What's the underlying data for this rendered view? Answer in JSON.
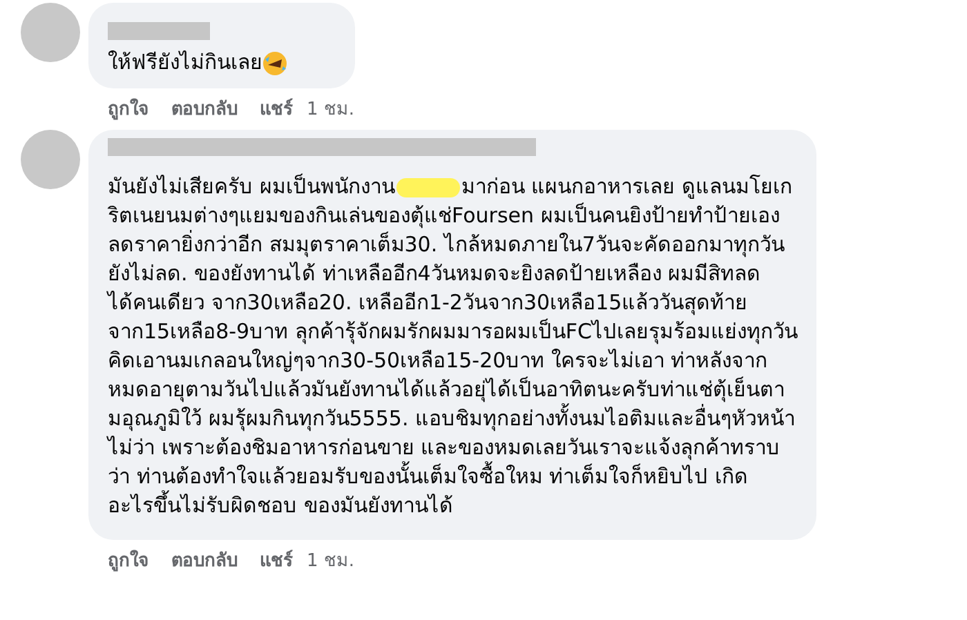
{
  "comments": [
    {
      "text_lines": [
        "ให้ฟรียังไม่กินเลย"
      ],
      "emoji": true,
      "redacted_first_line": false,
      "actions": [
        "ถูกใจ",
        "ตอบกลับ",
        "แชร์"
      ],
      "time": "1 ชม."
    },
    {
      "first_line_before": "มันยังไม่เสียครับ ผมเป็นพนักงาน",
      "first_line_after": "มาก่อน แผนกอาหารเลย ดูแลนมโยเก",
      "redacted_first_line": true,
      "emoji": false,
      "text_lines": [
        "ริตเนยนมต่างๆแยมของกินเล่นของตุ้แช่Foursen ผมเป็นคนยิงป้ายทำป้ายเอง",
        "ลดราคายิ่งกว่าอีก สมมุตราคาเต็ม30. ไกล้หมดภายใน7วันจะคัดออกมาทุกวัน",
        "ยังไม่ลด. ของยังทานได้ ท่าเหลืออีก4วันหมดจะยิงลดป้ายเหลือง ผมมีสิทลด",
        "ได้คนเดียว จาก30เหลือ20. เหลืออีก1-2วันจาก30เหลือ15แล้ววันสุดท้าย",
        "จาก15เหลือ8-9บาท ลุกค้ารุ้จักผมรักผมมารอผมเป็นFCไปเลยรุมร้อมแย่งทุกวัน",
        "คิดเอานมเกลอนใหญ่ๆจาก30-50เหลือ15-20บาท ใครจะไม่เอา ท่าหลังจาก",
        "หมดอายุตามวันไปแล้วมันยังทานได้แล้วอยุ่ได้เป็นอาทิตนะครับท่าแช่ตุ้เย็นตา",
        "มอุณภูมิใว้ ผมรุ้ผมกินทุกวัน5555. แอบชิมทุกอย่างทั้งนมไอติมและอื่นๆหัวหน้า",
        "ไม่ว่า เพราะต้องชิมอาหารก่อนขาย และของหมดเลยวันเราจะแจ้งลุกค้าทราบ",
        "ว่า ท่านต้องทำใจแล้วยอมรับของนั้นเต็มใจซื้อใหม ท่าเต็มใจก็หยิบไป เกิด",
        "อะไรขึ้นไม่รับผิดชอบ ของมันยังทานได้"
      ],
      "actions": [
        "ถูกใจ",
        "ตอบกลับ",
        "แชร์"
      ],
      "time": "1 ชม."
    }
  ]
}
